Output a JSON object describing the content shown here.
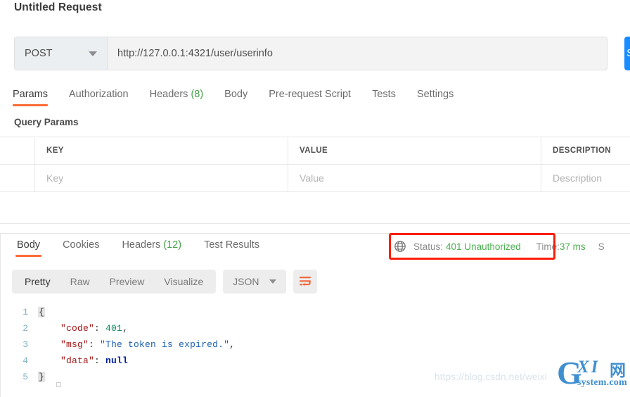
{
  "request": {
    "title": "Untitled Request",
    "method": "POST",
    "url": "http://127.0.0.1:4321/user/userinfo",
    "send_label": "Send",
    "tabs": [
      {
        "label": "Params",
        "count": "",
        "active": true
      },
      {
        "label": "Authorization",
        "count": "",
        "active": false
      },
      {
        "label": "Headers",
        "count": "(8)",
        "active": false
      },
      {
        "label": "Body",
        "count": "",
        "active": false
      },
      {
        "label": "Pre-request Script",
        "count": "",
        "active": false
      },
      {
        "label": "Tests",
        "count": "",
        "active": false
      },
      {
        "label": "Settings",
        "count": "",
        "active": false
      }
    ],
    "query_params_label": "Query Params",
    "table": {
      "headers": [
        "KEY",
        "VALUE",
        "DESCRIPTION"
      ],
      "rows": [
        {
          "key": "Key",
          "value": "Value",
          "description": "Description"
        }
      ]
    }
  },
  "response": {
    "tabs": [
      {
        "label": "Body",
        "count": "",
        "active": true
      },
      {
        "label": "Cookies",
        "count": "",
        "active": false
      },
      {
        "label": "Headers",
        "count": "(12)",
        "active": false
      },
      {
        "label": "Test Results",
        "count": "",
        "active": false
      }
    ],
    "status_label": "Status:",
    "status_value": "401 Unauthorized",
    "time_label": "Time:",
    "time_value": "37 ms",
    "size_label": "S",
    "globe_icon": "globe-icon",
    "viewer": {
      "modes": [
        {
          "label": "Pretty",
          "active": true
        },
        {
          "label": "Raw",
          "active": false
        },
        {
          "label": "Preview",
          "active": false
        },
        {
          "label": "Visualize",
          "active": false
        }
      ],
      "format": "JSON",
      "wrap_icon": "word-wrap-icon"
    },
    "body_lines": [
      {
        "n": "1",
        "tokens": [
          {
            "t": "brace",
            "s": "{"
          }
        ]
      },
      {
        "n": "2",
        "tokens": [
          {
            "t": "plain",
            "s": "    "
          },
          {
            "t": "key",
            "s": "\"code\""
          },
          {
            "t": "punc",
            "s": ": "
          },
          {
            "t": "num",
            "s": "401"
          },
          {
            "t": "punc",
            "s": ","
          }
        ]
      },
      {
        "n": "3",
        "tokens": [
          {
            "t": "plain",
            "s": "    "
          },
          {
            "t": "key",
            "s": "\"msg\""
          },
          {
            "t": "punc",
            "s": ": "
          },
          {
            "t": "str",
            "s": "\"The token is expired.\""
          },
          {
            "t": "punc",
            "s": ","
          }
        ]
      },
      {
        "n": "4",
        "tokens": [
          {
            "t": "plain",
            "s": "    "
          },
          {
            "t": "key",
            "s": "\"data\""
          },
          {
            "t": "punc",
            "s": ": "
          },
          {
            "t": "null",
            "s": "null"
          }
        ]
      },
      {
        "n": "5",
        "tokens": [
          {
            "t": "brace",
            "s": "}"
          }
        ]
      }
    ]
  },
  "watermark": {
    "url": "https://blog.csdn.net/weixi",
    "logo_g": "G",
    "logo_xi": "XI",
    "logo_cn": "网",
    "logo_sys": "system.com"
  },
  "colors": {
    "accent": "#ff6c37",
    "status_green": "#4caf50",
    "send_blue": "#1a8cff",
    "annotation_red": "#fa1d0b"
  }
}
